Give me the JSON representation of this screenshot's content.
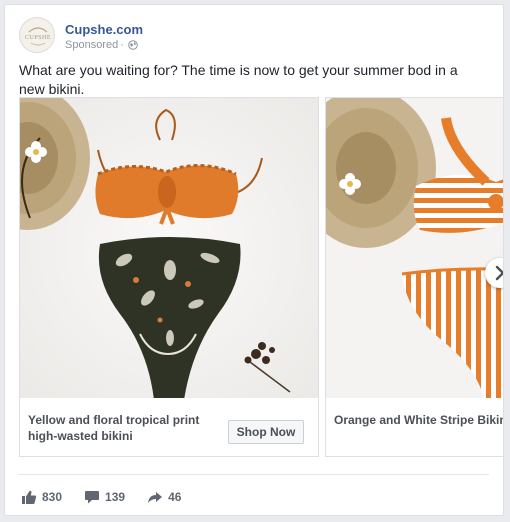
{
  "header": {
    "page_name": "Cupshe.com",
    "sponsored": "Sponsored",
    "separator": "·",
    "avatar_text": "CUPSHE"
  },
  "message": "What are you waiting for? The time is now to get your summer bod in a new bikini.",
  "cards": [
    {
      "title": "Yellow and floral tropical print high-wasted bikini",
      "button": "Shop Now"
    },
    {
      "title": "Orange and White Stripe Bikini with Bowknot"
    }
  ],
  "stats": {
    "likes": "830",
    "comments": "139",
    "shares": "46"
  },
  "colors": {
    "link_blue": "#365899",
    "bikini_orange": "#e0782a",
    "floral_dark": "#2f3326"
  },
  "icons": {
    "next": "chevron-right-icon",
    "like": "thumbs-up-icon",
    "comment": "comment-icon",
    "share": "share-icon",
    "audience": "globe-icon"
  }
}
